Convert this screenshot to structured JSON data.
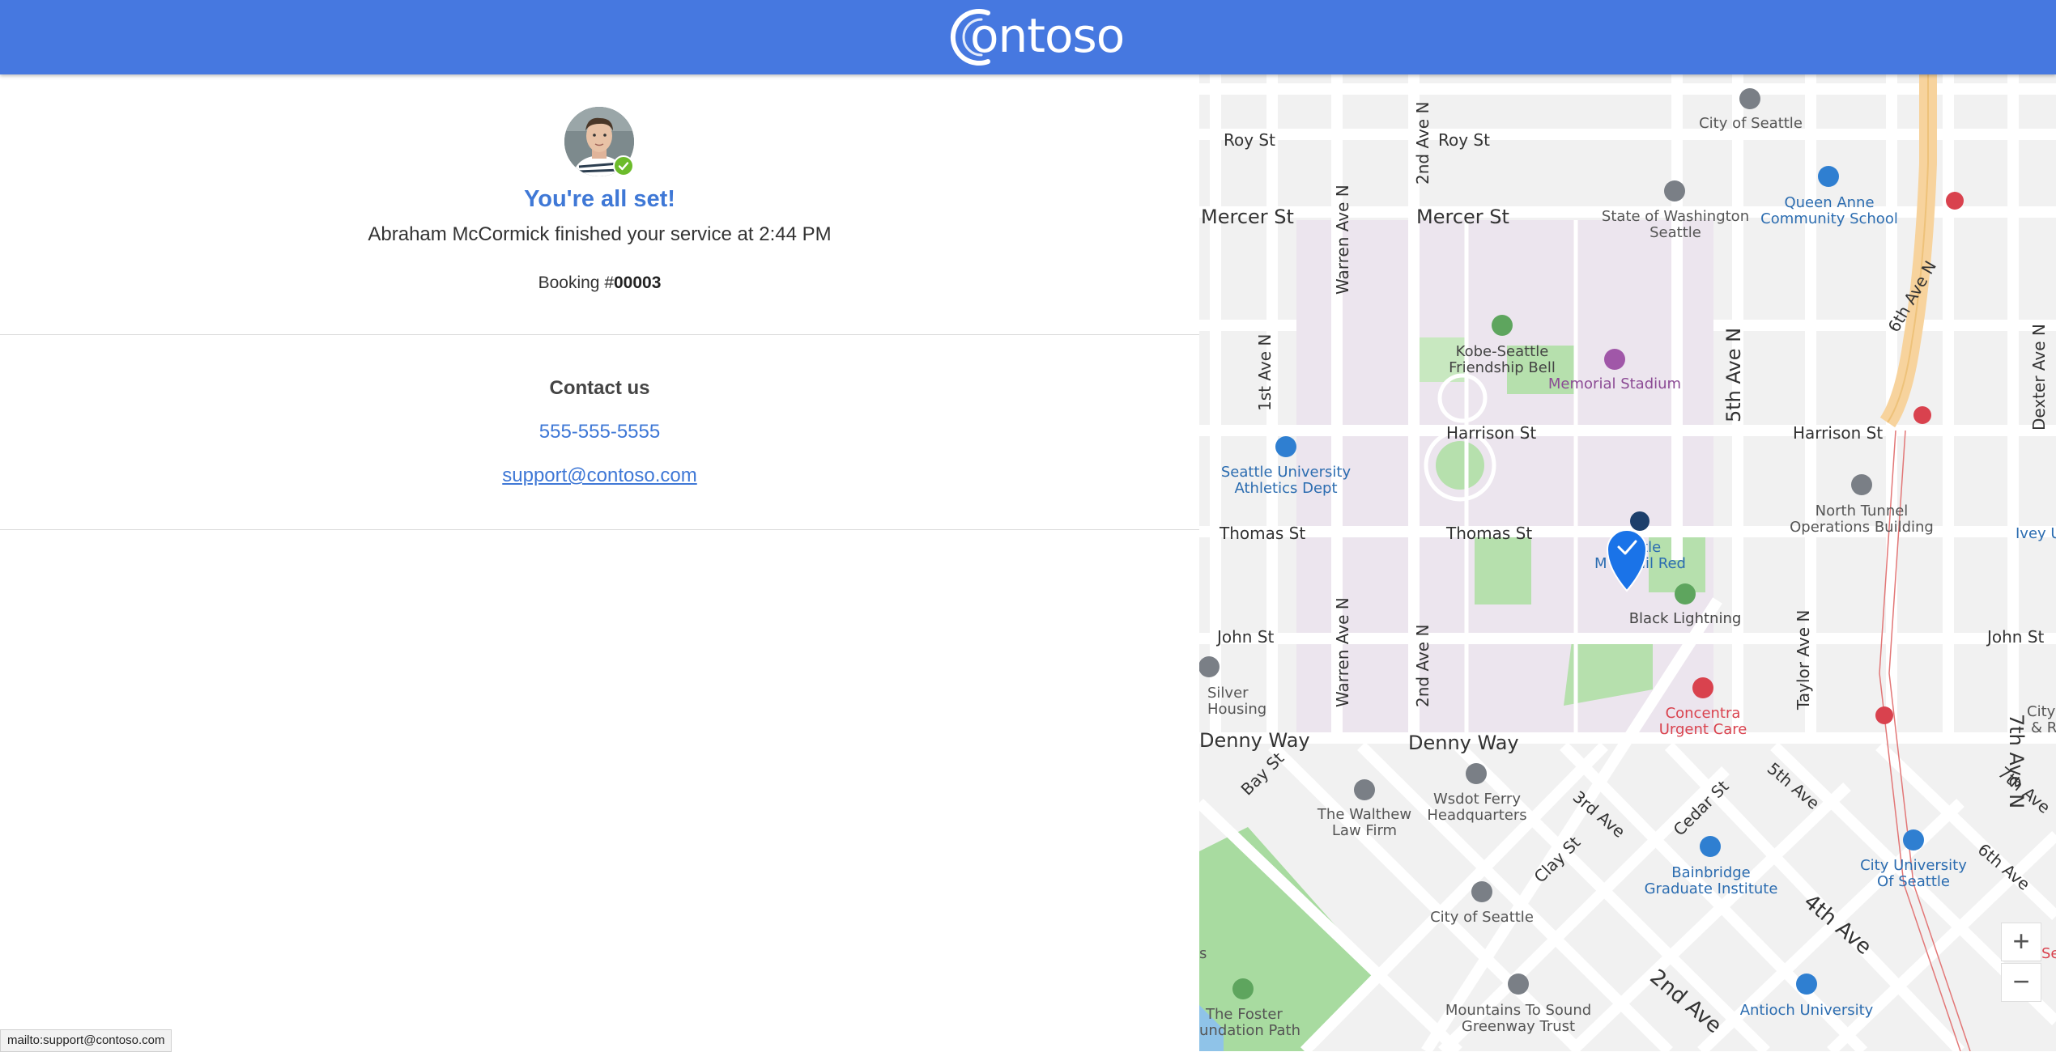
{
  "header": {
    "logo_text": "ontoso"
  },
  "confirmation": {
    "title": "You're all set!",
    "subtitle": "Abraham McCormick finished your service at 2:44 PM",
    "booking_prefix": "Booking #",
    "booking_number": "00003"
  },
  "contact": {
    "title": "Contact us",
    "phone": "555-555-5555",
    "email": "support@contoso.com"
  },
  "status_bar": {
    "text": "mailto:support@contoso.com"
  },
  "map": {
    "zoom_in": "+",
    "zoom_out": "−",
    "street_labels": [
      "Roy St",
      "Roy St",
      "Mercer St",
      "Mercer St",
      "Harrison St",
      "Harrison St",
      "Thomas St",
      "Thomas St",
      "John St",
      "John St",
      "Denny Way",
      "Denny Way",
      "Warren Ave N",
      "Warren Ave N",
      "2nd Ave N",
      "2nd Ave N",
      "1st Ave N",
      "5th Ave N",
      "Taylor Ave N",
      "6th Ave N",
      "7th Ave N",
      "Dexter Ave N",
      "Bay St",
      "3rd Ave",
      "Cedar St",
      "5th Ave",
      "Clay St",
      "4th Ave",
      "2nd Ave",
      "7th Ave",
      "6th Ave"
    ],
    "poi_labels": [
      "City of Seattle",
      "Queen Anne",
      "Community School",
      "State of Washington",
      "Seattle",
      "Kobe-Seattle",
      "Friendship Bell",
      "Memorial Stadium",
      "Seattle University",
      "Athletics Dept",
      "North Tunnel",
      "Operations Building",
      "Ivey U",
      "ttle",
      "M",
      "ail Red",
      "Black Lightning",
      "Silver",
      "Housing",
      "Concentra",
      "Urgent Care",
      "City Of S",
      "& Re",
      "The Walthew",
      "Law Firm",
      "Wsdot Ferry",
      "Headquarters",
      "Bainbridge",
      "Graduate Institute",
      "City University",
      "Of Seattle",
      "City of Seattle",
      "Mountains To Sound",
      "Greenway Trust",
      "Antioch University",
      "The Foster",
      "undation Path",
      "Se",
      "s"
    ]
  },
  "colors": {
    "header_bg": "#4678e0",
    "accent": "#3f78d6",
    "success": "#6cbb2b",
    "map_bg": "#f2f2f2",
    "campus": "#ece5ee",
    "park": "#b6e0ad",
    "highway": "#f7d39d",
    "pin": "#1a73e8"
  }
}
